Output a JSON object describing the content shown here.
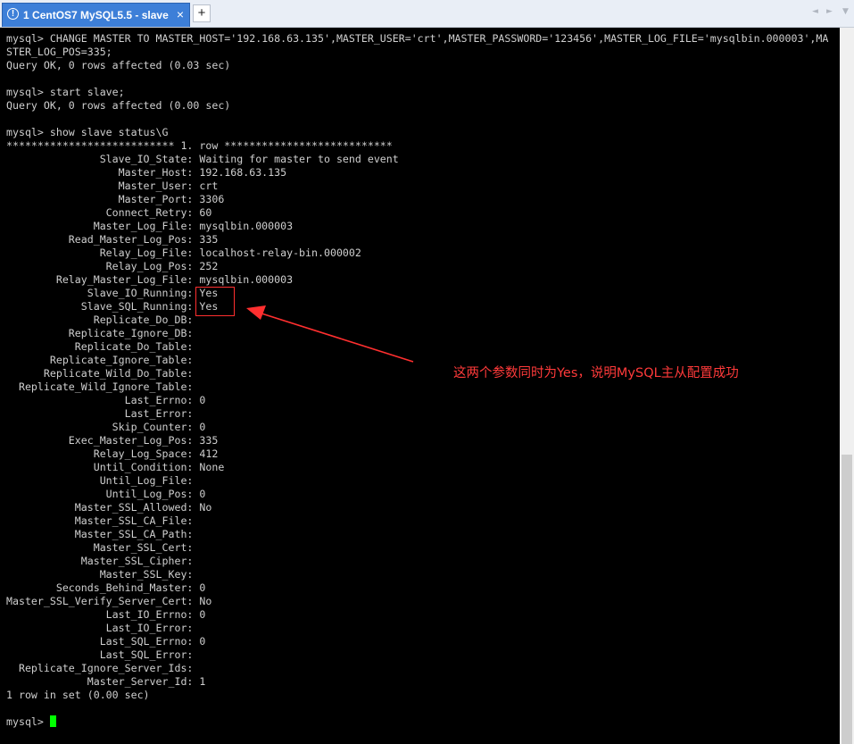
{
  "tab": {
    "index": "1",
    "title": "CentOS7 MySQL5.5 - slave",
    "close": "×",
    "warn": "!"
  },
  "newtab": "+",
  "nav": {
    "left": "◄",
    "right": "►",
    "menu": "▼"
  },
  "terminal": {
    "lines": [
      "mysql> CHANGE MASTER TO MASTER_HOST='192.168.63.135',MASTER_USER='crt',MASTER_PASSWORD='123456',MASTER_LOG_FILE='mysqlbin.000003',MA",
      "STER_LOG_POS=335;",
      "Query OK, 0 rows affected (0.03 sec)",
      "",
      "mysql> start slave;",
      "Query OK, 0 rows affected (0.00 sec)",
      "",
      "mysql> show slave status\\G",
      "*************************** 1. row ***************************",
      "               Slave_IO_State: Waiting for master to send event",
      "                  Master_Host: 192.168.63.135",
      "                  Master_User: crt",
      "                  Master_Port: 3306",
      "                Connect_Retry: 60",
      "              Master_Log_File: mysqlbin.000003",
      "          Read_Master_Log_Pos: 335",
      "               Relay_Log_File: localhost-relay-bin.000002",
      "                Relay_Log_Pos: 252",
      "        Relay_Master_Log_File: mysqlbin.000003",
      "             Slave_IO_Running: Yes",
      "            Slave_SQL_Running: Yes",
      "              Replicate_Do_DB:",
      "          Replicate_Ignore_DB:",
      "           Replicate_Do_Table:",
      "       Replicate_Ignore_Table:",
      "      Replicate_Wild_Do_Table:",
      "  Replicate_Wild_Ignore_Table:",
      "                   Last_Errno: 0",
      "                   Last_Error:",
      "                 Skip_Counter: 0",
      "          Exec_Master_Log_Pos: 335",
      "              Relay_Log_Space: 412",
      "              Until_Condition: None",
      "               Until_Log_File:",
      "                Until_Log_Pos: 0",
      "           Master_SSL_Allowed: No",
      "           Master_SSL_CA_File:",
      "           Master_SSL_CA_Path:",
      "              Master_SSL_Cert:",
      "            Master_SSL_Cipher:",
      "               Master_SSL_Key:",
      "        Seconds_Behind_Master: 0",
      "Master_SSL_Verify_Server_Cert: No",
      "                Last_IO_Errno: 0",
      "                Last_IO_Error:",
      "               Last_SQL_Errno: 0",
      "               Last_SQL_Error:",
      "  Replicate_Ignore_Server_Ids:",
      "             Master_Server_Id: 1",
      "1 row in set (0.00 sec)",
      ""
    ],
    "prompt": "mysql> "
  },
  "annotation": "这两个参数同时为Yes，说明MySQL主从配置成功",
  "colors": {
    "tab_active": "#3d7fd8",
    "terminal_bg": "#000000",
    "terminal_fg": "#cfcfcf",
    "cursor": "#00ff00",
    "annotation": "#ff3a3a"
  }
}
